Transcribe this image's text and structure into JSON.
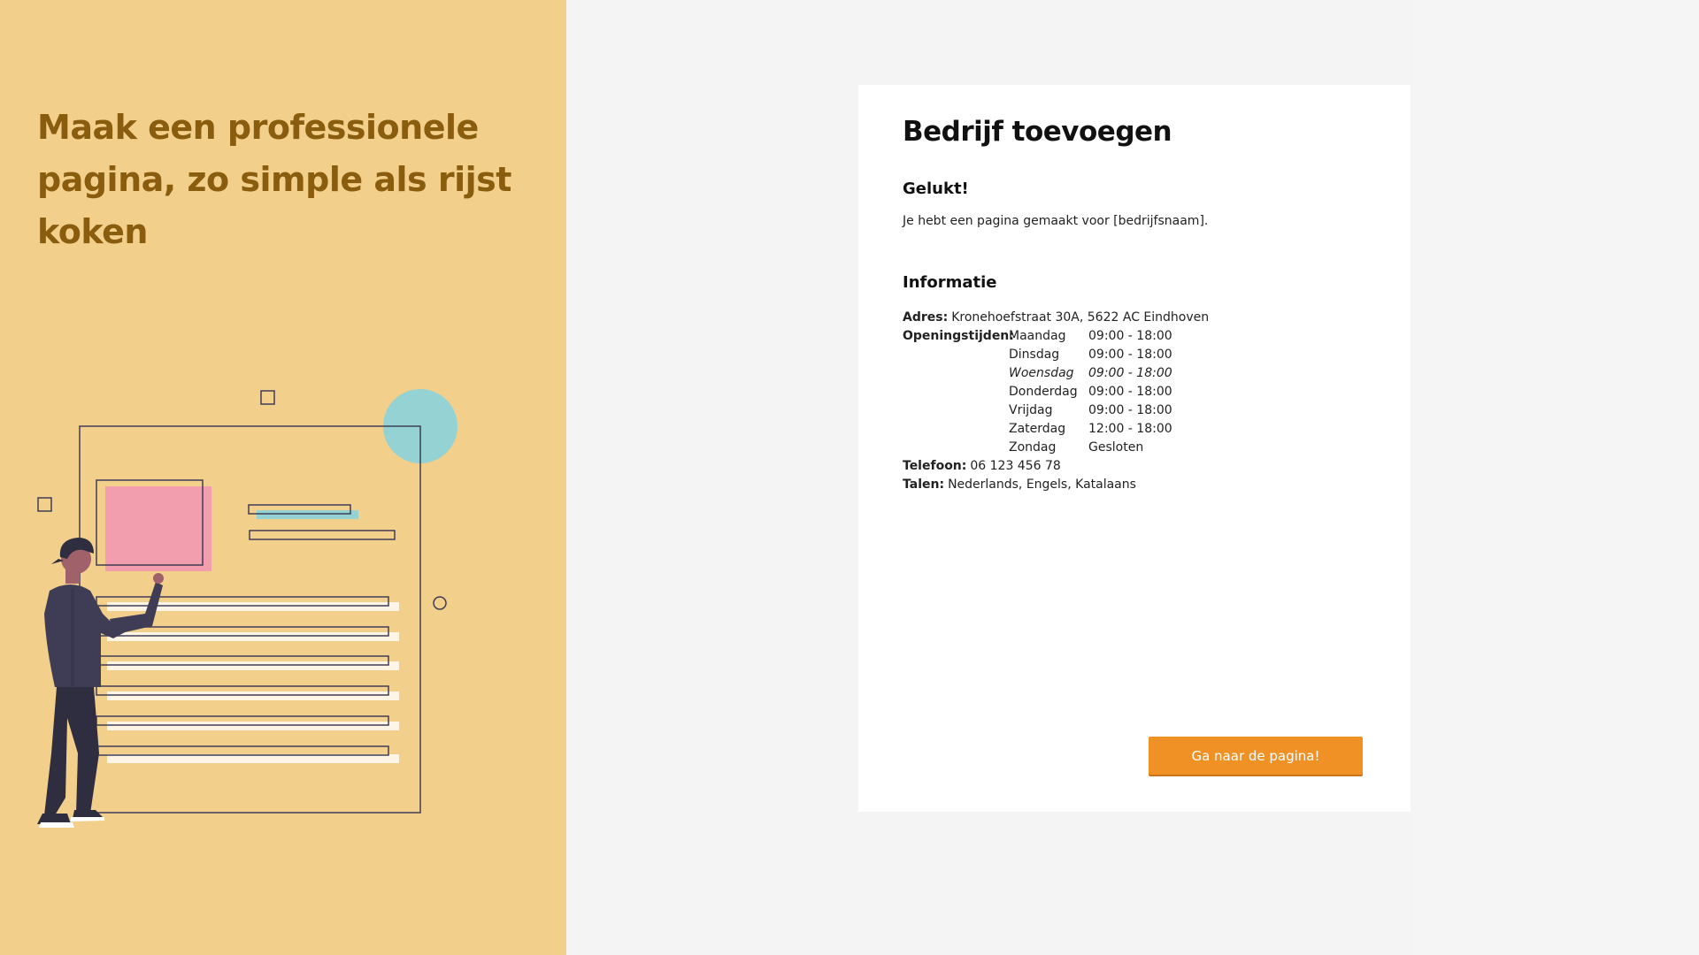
{
  "hero": {
    "title": "Maak een professionele pagina, zo simple als rijst koken"
  },
  "card": {
    "title": "Bedrijf toevoegen",
    "success_title": "Gelukt!",
    "success_text": "Je hebt een pagina gemaakt voor [bedrijfsnaam].",
    "info_title": "Informatie",
    "address_label": "Adres:",
    "address_value": "Kronehoefstraat 30A, 5622 AC Eindhoven",
    "hours_label": "Openingstijden:",
    "hours": [
      {
        "day": "Maandag",
        "time": "09:00 - 18:00"
      },
      {
        "day": "Dinsdag",
        "time": "09:00 - 18:00"
      },
      {
        "day": "Woensdag",
        "time": "09:00 - 18:00"
      },
      {
        "day": "Donderdag",
        "time": "09:00 - 18:00"
      },
      {
        "day": "Vrijdag",
        "time": "09:00 - 18:00"
      },
      {
        "day": "Zaterdag",
        "time": "12:00 - 18:00"
      },
      {
        "day": "Zondag",
        "time": "Gesloten"
      }
    ],
    "phone_label": "Telefoon:",
    "phone_value": "06 123 456 78",
    "languages_label": "Talen:",
    "languages_value": "Nederlands, Engels, Katalaans",
    "button_label": "Ga naar de pagina!"
  },
  "colors": {
    "left_bg": "#f2cf8b",
    "hero_text": "#8a5c0e",
    "button": "#ef9124",
    "accent_teal": "#94d2d3",
    "accent_pink": "#f29eaf"
  }
}
